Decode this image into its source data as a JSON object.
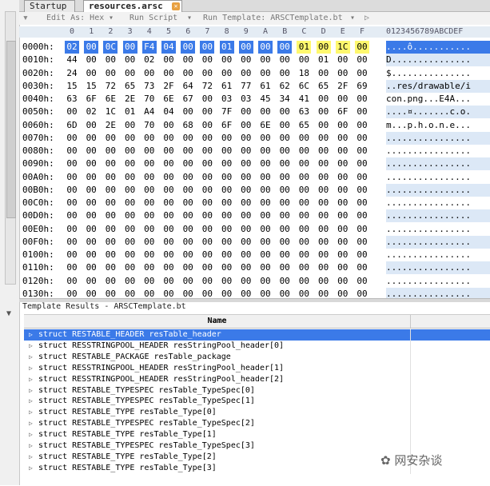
{
  "tabs": [
    {
      "label": "Startup"
    },
    {
      "label": "resources.arsc"
    }
  ],
  "toolbar": {
    "edit_as": "Edit As: Hex",
    "run_script": "Run Script",
    "run_template": "Run Template: ARSCTemplate.bt"
  },
  "columns": {
    "hex": [
      "0",
      "1",
      "2",
      "3",
      "4",
      "5",
      "6",
      "7",
      "8",
      "9",
      "A",
      "B",
      "C",
      "D",
      "E",
      "F"
    ],
    "ascii": "0123456789ABCDEF"
  },
  "rows": [
    {
      "offset": "0000h:",
      "bytes": [
        "02",
        "00",
        "0C",
        "00",
        "F4",
        "04",
        "00",
        "00",
        "01",
        "00",
        "00",
        "00",
        "01",
        "00",
        "1C",
        "00"
      ],
      "ascii": "....ô..........."
    },
    {
      "offset": "0010h:",
      "bytes": [
        "44",
        "00",
        "00",
        "00",
        "02",
        "00",
        "00",
        "00",
        "00",
        "00",
        "00",
        "00",
        "00",
        "01",
        "00",
        "00"
      ],
      "ascii": "D..............."
    },
    {
      "offset": "0020h:",
      "bytes": [
        "24",
        "00",
        "00",
        "00",
        "00",
        "00",
        "00",
        "00",
        "00",
        "00",
        "00",
        "00",
        "18",
        "00",
        "00",
        "00"
      ],
      "ascii": "$..............."
    },
    {
      "offset": "0030h:",
      "bytes": [
        "15",
        "15",
        "72",
        "65",
        "73",
        "2F",
        "64",
        "72",
        "61",
        "77",
        "61",
        "62",
        "6C",
        "65",
        "2F",
        "69"
      ],
      "ascii": "..res/drawable/i"
    },
    {
      "offset": "0040h:",
      "bytes": [
        "63",
        "6F",
        "6E",
        "2E",
        "70",
        "6E",
        "67",
        "00",
        "03",
        "03",
        "45",
        "34",
        "41",
        "00",
        "00",
        "00"
      ],
      "ascii": "con.png...E4A..."
    },
    {
      "offset": "0050h:",
      "bytes": [
        "00",
        "02",
        "1C",
        "01",
        "A4",
        "04",
        "00",
        "00",
        "7F",
        "00",
        "00",
        "00",
        "63",
        "00",
        "6F",
        "00"
      ],
      "ascii": "....¤.......c.o."
    },
    {
      "offset": "0060h:",
      "bytes": [
        "6D",
        "00",
        "2E",
        "00",
        "70",
        "00",
        "68",
        "00",
        "6F",
        "00",
        "6E",
        "00",
        "65",
        "00",
        "00",
        "00"
      ],
      "ascii": "m...p.h.o.n.e..."
    },
    {
      "offset": "0070h:",
      "bytes": [
        "00",
        "00",
        "00",
        "00",
        "00",
        "00",
        "00",
        "00",
        "00",
        "00",
        "00",
        "00",
        "00",
        "00",
        "00",
        "00"
      ],
      "ascii": "................"
    },
    {
      "offset": "0080h:",
      "bytes": [
        "00",
        "00",
        "00",
        "00",
        "00",
        "00",
        "00",
        "00",
        "00",
        "00",
        "00",
        "00",
        "00",
        "00",
        "00",
        "00"
      ],
      "ascii": "................"
    },
    {
      "offset": "0090h:",
      "bytes": [
        "00",
        "00",
        "00",
        "00",
        "00",
        "00",
        "00",
        "00",
        "00",
        "00",
        "00",
        "00",
        "00",
        "00",
        "00",
        "00"
      ],
      "ascii": "................"
    },
    {
      "offset": "00A0h:",
      "bytes": [
        "00",
        "00",
        "00",
        "00",
        "00",
        "00",
        "00",
        "00",
        "00",
        "00",
        "00",
        "00",
        "00",
        "00",
        "00",
        "00"
      ],
      "ascii": "................"
    },
    {
      "offset": "00B0h:",
      "bytes": [
        "00",
        "00",
        "00",
        "00",
        "00",
        "00",
        "00",
        "00",
        "00",
        "00",
        "00",
        "00",
        "00",
        "00",
        "00",
        "00"
      ],
      "ascii": "................"
    },
    {
      "offset": "00C0h:",
      "bytes": [
        "00",
        "00",
        "00",
        "00",
        "00",
        "00",
        "00",
        "00",
        "00",
        "00",
        "00",
        "00",
        "00",
        "00",
        "00",
        "00"
      ],
      "ascii": "................"
    },
    {
      "offset": "00D0h:",
      "bytes": [
        "00",
        "00",
        "00",
        "00",
        "00",
        "00",
        "00",
        "00",
        "00",
        "00",
        "00",
        "00",
        "00",
        "00",
        "00",
        "00"
      ],
      "ascii": "................"
    },
    {
      "offset": "00E0h:",
      "bytes": [
        "00",
        "00",
        "00",
        "00",
        "00",
        "00",
        "00",
        "00",
        "00",
        "00",
        "00",
        "00",
        "00",
        "00",
        "00",
        "00"
      ],
      "ascii": "................"
    },
    {
      "offset": "00F0h:",
      "bytes": [
        "00",
        "00",
        "00",
        "00",
        "00",
        "00",
        "00",
        "00",
        "00",
        "00",
        "00",
        "00",
        "00",
        "00",
        "00",
        "00"
      ],
      "ascii": "................"
    },
    {
      "offset": "0100h:",
      "bytes": [
        "00",
        "00",
        "00",
        "00",
        "00",
        "00",
        "00",
        "00",
        "00",
        "00",
        "00",
        "00",
        "00",
        "00",
        "00",
        "00"
      ],
      "ascii": "................"
    },
    {
      "offset": "0110h:",
      "bytes": [
        "00",
        "00",
        "00",
        "00",
        "00",
        "00",
        "00",
        "00",
        "00",
        "00",
        "00",
        "00",
        "00",
        "00",
        "00",
        "00"
      ],
      "ascii": "................"
    },
    {
      "offset": "0120h:",
      "bytes": [
        "00",
        "00",
        "00",
        "00",
        "00",
        "00",
        "00",
        "00",
        "00",
        "00",
        "00",
        "00",
        "00",
        "00",
        "00",
        "00"
      ],
      "ascii": "................"
    },
    {
      "offset": "0130h:",
      "bytes": [
        "00",
        "00",
        "00",
        "00",
        "00",
        "00",
        "00",
        "00",
        "00",
        "00",
        "00",
        "00",
        "00",
        "00",
        "00",
        "00"
      ],
      "ascii": "................"
    }
  ],
  "template": {
    "title": "Template Results - ARSCTemplate.bt",
    "col_name": "Name",
    "items": [
      "struct RESTABLE_HEADER resTable_header",
      "struct RESSTRINGPOOL_HEADER resStringPool_header[0]",
      "struct RESTABLE_PACKAGE resTable_package",
      "struct RESSTRINGPOOL_HEADER resStringPool_header[1]",
      "struct RESSTRINGPOOL_HEADER resStringPool_header[2]",
      "struct RESTABLE_TYPESPEC resTable_TypeSpec[0]",
      "struct RESTABLE_TYPESPEC resTable_TypeSpec[1]",
      "struct RESTABLE_TYPE resTable_Type[0]",
      "struct RESTABLE_TYPESPEC resTable_TypeSpec[2]",
      "struct RESTABLE_TYPE resTable_Type[1]",
      "struct RESTABLE_TYPESPEC resTable_TypeSpec[3]",
      "struct RESTABLE_TYPE resTable_Type[2]",
      "struct RESTABLE_TYPE resTable_Type[3]"
    ]
  },
  "watermark": "网安杂谈",
  "colors": {
    "selection": "#3b7ae8",
    "highlight_yellow": "#fff86e"
  }
}
